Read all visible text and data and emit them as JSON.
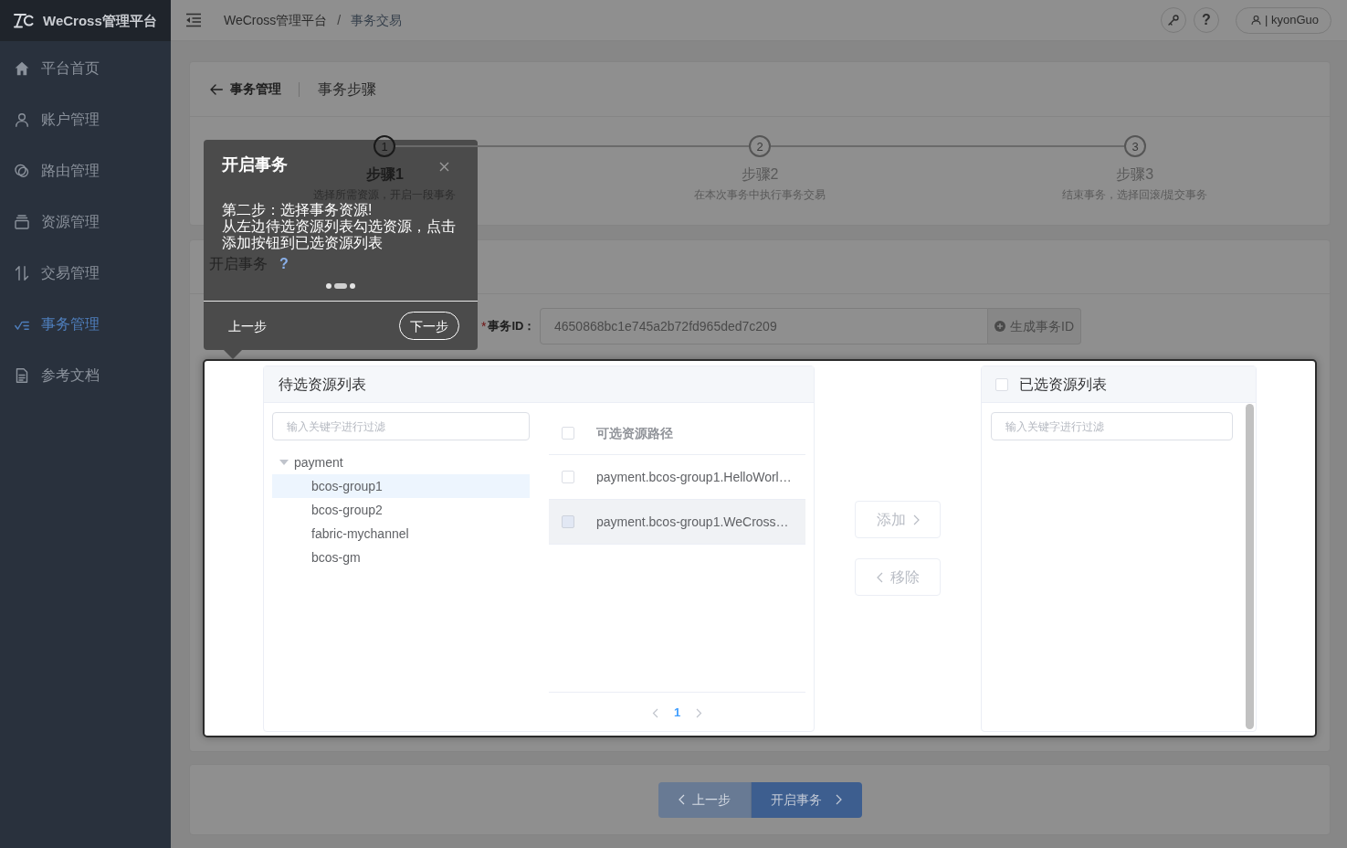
{
  "sidebar": {
    "logo": "WeCross管理平台",
    "items": [
      {
        "label": "平台首页",
        "selected": false
      },
      {
        "label": "账户管理",
        "selected": false
      },
      {
        "label": "路由管理",
        "selected": false
      },
      {
        "label": "资源管理",
        "selected": false
      },
      {
        "label": "交易管理",
        "selected": false
      },
      {
        "label": "事务管理",
        "selected": true
      },
      {
        "label": "参考文档",
        "selected": false
      }
    ]
  },
  "header": {
    "breadcrumb": {
      "separator": "/",
      "items": [
        {
          "label": "WeCross管理平台",
          "current": false
        },
        {
          "label": "事务交易",
          "current": true
        }
      ]
    },
    "help": "?",
    "user": "| kyonGuo"
  },
  "page_header": {
    "back": "事务管理",
    "title": "事务步骤"
  },
  "steps": [
    {
      "number": "1",
      "title": "步骤1",
      "description": "选择所需资源，开启一段事务",
      "active": true
    },
    {
      "number": "2",
      "title": "步骤2",
      "description": "在本次事务中执行事务交易",
      "active": false
    },
    {
      "number": "3",
      "title": "步骤3",
      "description": "结束事务，选择回滚/提交事务",
      "active": false
    }
  ],
  "form": {
    "title": "开启事务",
    "help_mark": "?",
    "required_mark": "*",
    "id_label": "事务ID：",
    "id_value": "4650868bc1e745a2b72fd965ded7c209",
    "generate_button": "生成事务ID"
  },
  "transfer": {
    "source": {
      "title": "待选资源列表",
      "filter_placeholder": "输入关键字进行过滤",
      "tree": [
        {
          "label": "payment",
          "expanded": true,
          "selected": false,
          "children": [
            {
              "label": "bcos-group1",
              "selected": true
            },
            {
              "label": "bcos-group2",
              "selected": false
            },
            {
              "label": "fabric-mychannel",
              "selected": false
            },
            {
              "label": "bcos-gm",
              "selected": false
            }
          ]
        }
      ],
      "table": {
        "header": "可选资源路径",
        "header_checked": false,
        "rows": [
          {
            "path": "payment.bcos-group1.HelloWorl…",
            "checked": false,
            "disabled": false,
            "hovered": false
          },
          {
            "path": "payment.bcos-group1.WeCross…",
            "checked": false,
            "disabled": true,
            "hovered": true
          }
        ]
      },
      "pagination": {
        "prev_disabled": true,
        "pages": [
          {
            "label": "1",
            "selected": true
          }
        ],
        "next_disabled": true
      }
    },
    "add": {
      "label": "添加",
      "disabled": true
    },
    "remove": {
      "label": "移除",
      "disabled": true
    },
    "target": {
      "title": "已选资源列表",
      "checked": false,
      "filter_placeholder": "输入关键字进行过滤"
    }
  },
  "footer": {
    "prev": {
      "label": "上一步",
      "disabled": true
    },
    "next": {
      "label": "开启事务",
      "disabled": false
    }
  },
  "tour": {
    "title": "开启事务",
    "body": [
      "第二步：选择事务资源!",
      "从左边待选资源列表勾选资源，点击添加按钮到已选资源列表"
    ],
    "progress": [
      {
        "selected": false
      },
      {
        "selected": true
      },
      {
        "selected": false
      }
    ],
    "prev": "上一步",
    "next": "下一步"
  }
}
